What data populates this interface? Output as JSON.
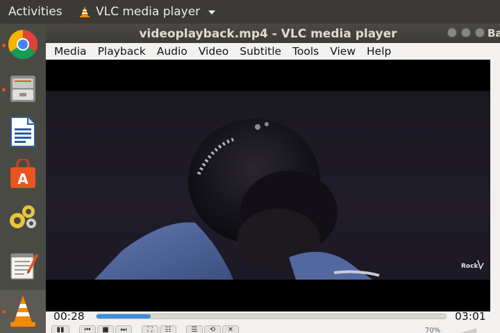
{
  "topbar": {
    "activities": "Activities",
    "app_name": "VLC media player"
  },
  "dock": {
    "items": [
      {
        "name": "chrome",
        "running": true
      },
      {
        "name": "files",
        "running": true
      },
      {
        "name": "writer",
        "running": false
      },
      {
        "name": "software-center",
        "running": false
      },
      {
        "name": "system-settings",
        "running": false
      },
      {
        "name": "text-editor",
        "running": false
      },
      {
        "name": "vlc",
        "running": true
      }
    ]
  },
  "window": {
    "title": "videoplayback.mp4 - VLC media player",
    "behind_title": "Ba"
  },
  "menubar": {
    "items": [
      "Media",
      "Playback",
      "Audio",
      "Video",
      "Subtitle",
      "Tools",
      "View",
      "Help"
    ]
  },
  "video": {
    "watermark": "Rock"
  },
  "playback": {
    "elapsed": "00:28",
    "total": "03:01",
    "progress_fraction": 0.155,
    "volume": "70%"
  },
  "colors": {
    "accent": "#3b8ede",
    "vlc_orange": "#f28a00",
    "ubuntu_orange": "#e95420"
  }
}
